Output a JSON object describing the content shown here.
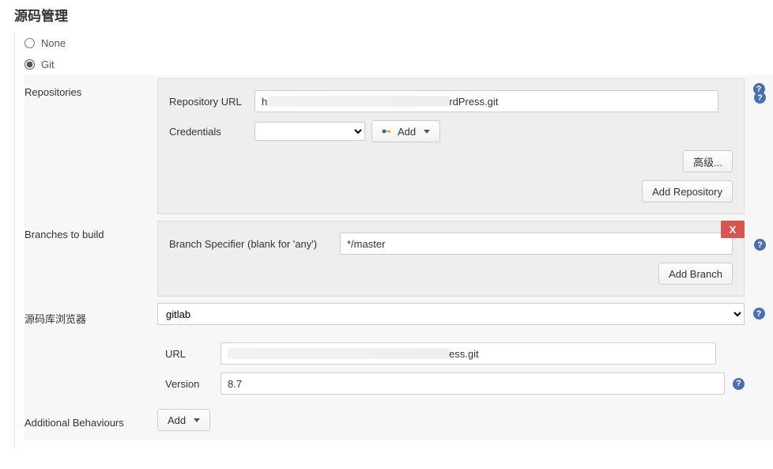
{
  "section_title": "源码管理",
  "scm": {
    "none_label": "None",
    "git_label": "Git"
  },
  "repositories": {
    "label": "Repositories",
    "repo_url_label": "Repository URL",
    "repo_url_value_prefix": "h",
    "repo_url_value_suffix": "rdPress.git",
    "credentials_label": "Credentials",
    "credentials_value": " ",
    "add_btn": "Add",
    "advanced_btn": "高级...",
    "add_repository_btn": "Add Repository"
  },
  "branches": {
    "label": "Branches to build",
    "specifier_label": "Branch Specifier (blank for 'any')",
    "specifier_value": "*/master",
    "add_branch_btn": "Add Branch",
    "delete_btn": "X"
  },
  "browser": {
    "label": "源码库浏览器",
    "selected": "gitlab",
    "url_label": "URL",
    "url_value_suffix": "ess.git",
    "version_label": "Version",
    "version_value": "8.7"
  },
  "additional": {
    "label": "Additional Behaviours",
    "add_btn": "Add"
  },
  "help_tooltip": "?"
}
